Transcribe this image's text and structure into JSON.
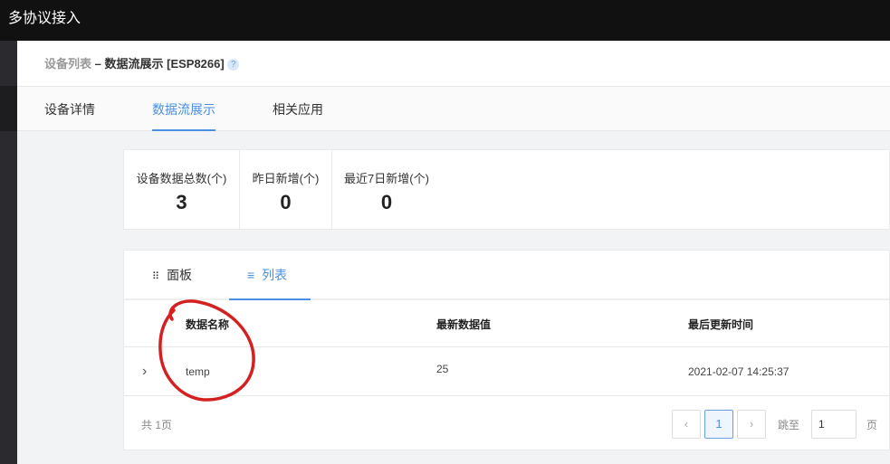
{
  "app_title": "多协议接入",
  "breadcrumb": {
    "parent": "设备列表",
    "separator": "–",
    "current": "数据流展示 [ESP8266]",
    "help": "?"
  },
  "tabs": [
    {
      "label": "设备详情"
    },
    {
      "label": "数据流展示",
      "active": true
    },
    {
      "label": "相关应用"
    }
  ],
  "stats": [
    {
      "label": "设备数据总数(个)",
      "value": "3"
    },
    {
      "label": "昨日新增(个)",
      "value": "0"
    },
    {
      "label": "最近7日新增(个)",
      "value": "0"
    }
  ],
  "view_tabs": [
    {
      "label": "面板",
      "icon": "grid-icon"
    },
    {
      "label": "列表",
      "icon": "list-icon",
      "active": true
    }
  ],
  "table": {
    "headers": [
      "数据名称",
      "最新数据值",
      "最后更新时间"
    ],
    "rows": [
      {
        "name": "temp",
        "value": "25",
        "time": "2021-02-07 14:25:37"
      }
    ]
  },
  "pagination": {
    "total": "共 1页",
    "current": "1",
    "jump_label": "跳至",
    "jump_value": "1",
    "page_suffix": "页",
    "prev": "‹",
    "next": "›"
  },
  "colors": {
    "accent": "#4a90e2",
    "annotation": "#d42020"
  }
}
